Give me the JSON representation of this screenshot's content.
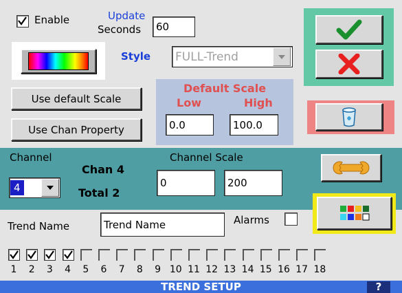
{
  "enable": {
    "label": "Enable",
    "checked": true
  },
  "update": {
    "line1": "Update",
    "line2": "Seconds",
    "value": "60"
  },
  "style": {
    "label": "Style",
    "value": "FULL-Trend"
  },
  "scale_buttons": {
    "use_default": "Use default Scale",
    "use_chan_property": "Use Chan Property"
  },
  "default_scale": {
    "title": "Default Scale",
    "low_label": "Low",
    "high_label": "High",
    "low_value": "0.0",
    "high_value": "100.0"
  },
  "channel": {
    "label": "Channel",
    "selected": "4",
    "chan_text": "Chan 4",
    "total_text": "Total 2"
  },
  "channel_scale": {
    "label": "Channel Scale",
    "low": "0",
    "high": "200"
  },
  "trend_name": {
    "label": "Trend Name",
    "value": "Trend Name"
  },
  "alarms": {
    "label": "Alarms",
    "checked": false
  },
  "channels_row": {
    "numbers": [
      "1",
      "2",
      "3",
      "4",
      "5",
      "6",
      "7",
      "8",
      "9",
      "10",
      "11",
      "12",
      "13",
      "14",
      "15",
      "16",
      "17",
      "18"
    ],
    "checked": [
      true,
      true,
      true,
      true,
      false,
      false,
      false,
      false,
      false,
      false,
      false,
      false,
      false,
      false,
      false,
      false,
      false,
      false
    ]
  },
  "footer": {
    "title": "TREND SETUP",
    "help": "?"
  },
  "icons": [
    "checkmark-icon",
    "x-icon",
    "trash-icon",
    "wrench-icon",
    "color-palette-icon",
    "color-gradient-icon",
    "dropdown-arrow-icon"
  ],
  "colors": {
    "background": "#e4e4e4",
    "teal_panel": "#4f9ea3",
    "ok_cancel_frame": "#62c8a6",
    "delete_frame": "#ef8484",
    "default_scale_panel": "#b6c4de",
    "palette_frame": "#f2ea18",
    "label_blue": "#1a3fd8",
    "label_red": "#e05050",
    "footer_blue": "#3a6fdc"
  }
}
